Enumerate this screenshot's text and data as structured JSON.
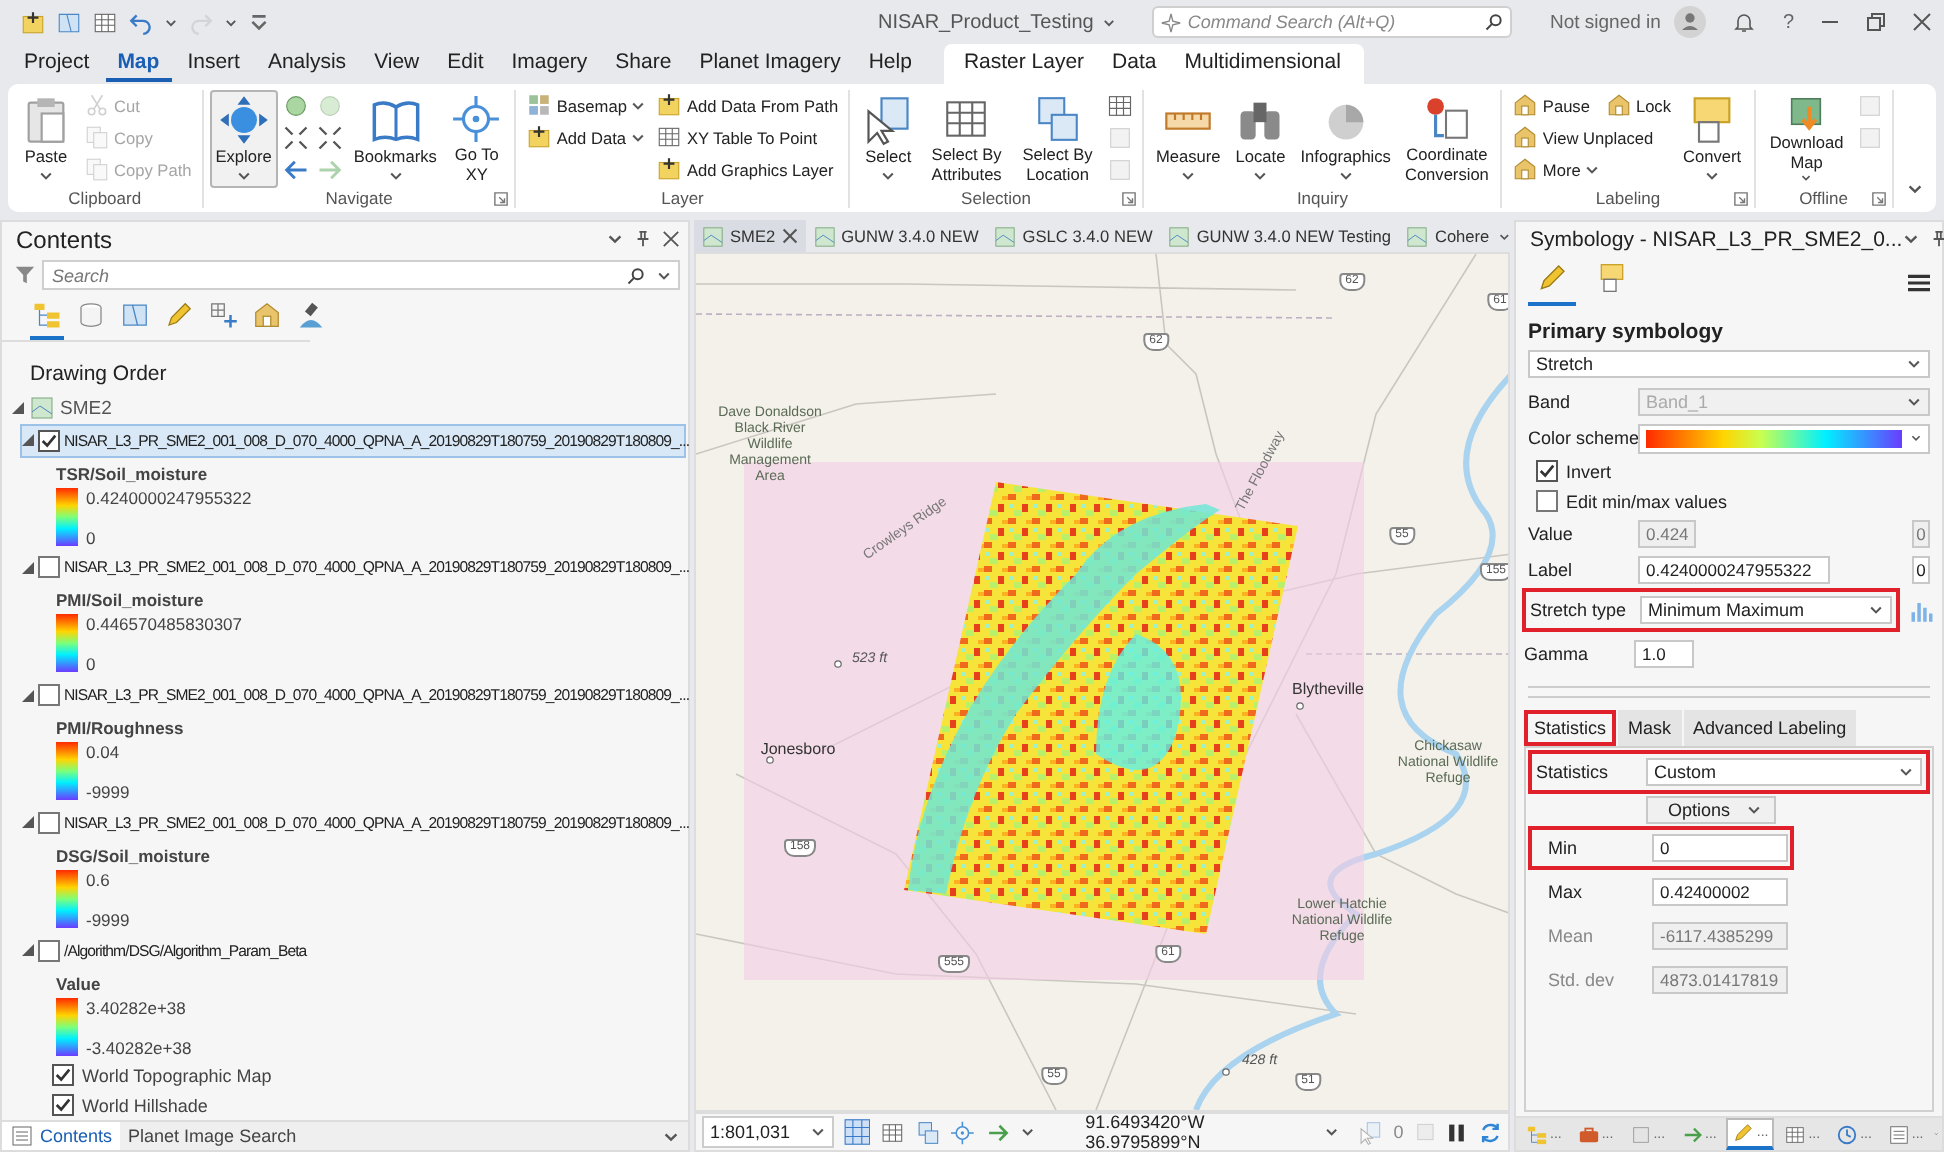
{
  "title_bar": {
    "title": "NISAR_Product_Testing",
    "search_placeholder": "Command Search (Alt+Q)",
    "account": "Not signed in",
    "help": "?"
  },
  "menu_tabs": [
    {
      "label": "Project",
      "selected": false,
      "kind": "core"
    },
    {
      "label": "Map",
      "selected": true,
      "kind": "core"
    },
    {
      "label": "Insert",
      "selected": false,
      "kind": "core"
    },
    {
      "label": "Analysis",
      "selected": false,
      "kind": "core"
    },
    {
      "label": "View",
      "selected": false,
      "kind": "core"
    },
    {
      "label": "Edit",
      "selected": false,
      "kind": "core"
    },
    {
      "label": "Imagery",
      "selected": false,
      "kind": "core"
    },
    {
      "label": "Share",
      "selected": false,
      "kind": "core"
    },
    {
      "label": "Planet Imagery",
      "selected": false,
      "kind": "core"
    },
    {
      "label": "Help",
      "selected": false,
      "kind": "core"
    },
    {
      "label": "Raster Layer",
      "selected": false,
      "kind": "context"
    },
    {
      "label": "Data",
      "selected": false,
      "kind": "context"
    },
    {
      "label": "Multidimensional",
      "selected": false,
      "kind": "context"
    }
  ],
  "ribbon": {
    "groups": [
      {
        "label": "Clipboard",
        "launcher": false,
        "columns": [
          [
            [
              {
                "kind": "large",
                "label": "Paste",
                "dropdown": true,
                "disabled": false,
                "active": false
              }
            ]
          ],
          [
            [
              {
                "kind": "small",
                "label": "Cut",
                "dropdown": false,
                "disabled": true,
                "active": false
              }
            ],
            [
              {
                "kind": "small",
                "label": "Copy",
                "dropdown": false,
                "disabled": true,
                "active": false
              }
            ],
            [
              {
                "kind": "small",
                "label": "Copy Path",
                "dropdown": false,
                "disabled": true,
                "active": false
              }
            ]
          ]
        ]
      },
      {
        "label": "Navigate",
        "launcher": true,
        "columns": [
          [
            [
              {
                "kind": "large",
                "label": "Explore",
                "dropdown": true,
                "disabled": false,
                "active": true
              }
            ]
          ],
          [
            [
              {
                "kind": "icon",
                "dropdown": false,
                "disabled": false,
                "active": false
              }
            ],
            [
              {
                "kind": "icon",
                "dropdown": false,
                "disabled": false,
                "active": false
              }
            ],
            [
              {
                "kind": "icon",
                "dropdown": false,
                "disabled": false,
                "active": false
              }
            ]
          ],
          [
            [
              {
                "kind": "icon",
                "dropdown": false,
                "disabled": true,
                "active": false
              }
            ],
            [
              {
                "kind": "icon",
                "dropdown": false,
                "disabled": false,
                "active": false
              }
            ],
            [
              {
                "kind": "icon",
                "dropdown": false,
                "disabled": true,
                "active": false
              }
            ]
          ],
          [
            [
              {
                "kind": "large",
                "label": "Bookmarks",
                "dropdown": true,
                "disabled": false,
                "active": false
              }
            ]
          ],
          [
            [
              {
                "kind": "large",
                "label": "Go To XY",
                "dropdown": false,
                "disabled": false,
                "active": false
              }
            ]
          ]
        ]
      },
      {
        "label": "Layer",
        "launcher": false,
        "columns": [
          [
            [
              {
                "kind": "small",
                "label": "Basemap",
                "dropdown": true,
                "disabled": false,
                "active": false
              }
            ],
            [
              {
                "kind": "small",
                "label": "Add Data",
                "dropdown": true,
                "disabled": false,
                "active": false
              }
            ]
          ],
          [
            [
              {
                "kind": "small",
                "label": "Add Data From Path",
                "dropdown": false,
                "disabled": false,
                "active": false
              }
            ],
            [
              {
                "kind": "small",
                "label": "XY Table To Point",
                "dropdown": false,
                "disabled": false,
                "active": false
              }
            ],
            [
              {
                "kind": "small",
                "label": "Add Graphics Layer",
                "dropdown": false,
                "disabled": false,
                "active": false
              }
            ]
          ]
        ]
      },
      {
        "label": "Selection",
        "launcher": true,
        "columns": [
          [
            [
              {
                "kind": "large",
                "label": "Select",
                "dropdown": true,
                "disabled": false,
                "active": false
              }
            ]
          ],
          [
            [
              {
                "kind": "large",
                "label": "Select By Attributes",
                "dropdown": false,
                "disabled": false,
                "active": false
              }
            ]
          ],
          [
            [
              {
                "kind": "large",
                "label": "Select By Location",
                "dropdown": false,
                "disabled": false,
                "active": false
              }
            ]
          ],
          [
            [
              {
                "kind": "icon",
                "dropdown": false,
                "disabled": false,
                "active": false
              }
            ],
            [
              {
                "kind": "icon",
                "dropdown": false,
                "disabled": true,
                "active": false
              }
            ],
            [
              {
                "kind": "icon",
                "dropdown": false,
                "disabled": true,
                "active": false
              }
            ]
          ]
        ]
      },
      {
        "label": "Inquiry",
        "launcher": false,
        "columns": [
          [
            [
              {
                "kind": "large",
                "label": "Measure",
                "dropdown": true,
                "disabled": false,
                "active": false
              }
            ]
          ],
          [
            [
              {
                "kind": "large",
                "label": "Locate",
                "dropdown": true,
                "disabled": false,
                "active": false
              }
            ]
          ],
          [
            [
              {
                "kind": "large",
                "label": "Infographics",
                "dropdown": true,
                "disabled": false,
                "active": false
              }
            ]
          ],
          [
            [
              {
                "kind": "large",
                "label": "Coordinate Conversion",
                "dropdown": false,
                "disabled": false,
                "active": false
              }
            ]
          ]
        ]
      },
      {
        "label": "Labeling",
        "launcher": true,
        "columns": [
          [
            [
              {
                "kind": "small",
                "label": "Pause",
                "dropdown": false,
                "disabled": false,
                "active": false
              },
              {
                "kind": "small",
                "label": "Lock",
                "dropdown": false,
                "disabled": false,
                "active": false
              }
            ],
            [
              {
                "kind": "small",
                "label": "View Unplaced",
                "dropdown": false,
                "disabled": false,
                "active": false
              }
            ],
            [
              {
                "kind": "small",
                "label": "More",
                "dropdown": true,
                "disabled": false,
                "active": false
              }
            ]
          ],
          [
            [
              {
                "kind": "large",
                "label": "Convert",
                "dropdown": true,
                "disabled": false,
                "active": false
              }
            ]
          ]
        ]
      },
      {
        "label": "Offline",
        "launcher": true,
        "columns": [
          [
            [
              {
                "kind": "large",
                "label": "Download Map",
                "dropdown": true,
                "disabled": false,
                "active": false
              }
            ]
          ],
          [
            [
              {
                "kind": "icon",
                "dropdown": false,
                "disabled": true,
                "active": false
              }
            ],
            [
              {
                "kind": "icon",
                "dropdown": false,
                "disabled": true,
                "active": false
              }
            ]
          ]
        ]
      }
    ]
  },
  "contents": {
    "title": "Contents",
    "search_placeholder": "Search",
    "view_tabs": [
      {
        "selected": true
      },
      {
        "selected": false
      },
      {
        "selected": false
      },
      {
        "selected": false
      },
      {
        "selected": false
      },
      {
        "selected": false
      },
      {
        "selected": false
      }
    ],
    "heading": "Drawing Order",
    "map": {
      "name": "SME2",
      "expanded": true,
      "children": [
        {
          "kind": "raster",
          "name": "NISAR_L3_PR_SME2_001_008_D_070_4000_QPNA_A_20190829T180759_20190829T180809_...",
          "checked": true,
          "selected": true,
          "expanded": true,
          "legend": {
            "field": "TSR/Soil_moisture",
            "max": "0.4240000247955322",
            "min": "0"
          }
        },
        {
          "kind": "raster",
          "name": "NISAR_L3_PR_SME2_001_008_D_070_4000_QPNA_A_20190829T180759_20190829T180809_...",
          "checked": false,
          "selected": false,
          "expanded": true,
          "legend": {
            "field": "PMI/Soil_moisture",
            "max": "0.446570485830307",
            "min": "0"
          }
        },
        {
          "kind": "raster",
          "name": "NISAR_L3_PR_SME2_001_008_D_070_4000_QPNA_A_20190829T180759_20190829T180809_...",
          "checked": false,
          "selected": false,
          "expanded": true,
          "legend": {
            "field": "PMI/Roughness",
            "max": "0.04",
            "min": "-9999"
          }
        },
        {
          "kind": "raster",
          "name": "NISAR_L3_PR_SME2_001_008_D_070_4000_QPNA_A_20190829T180759_20190829T180809_...",
          "checked": false,
          "selected": false,
          "expanded": true,
          "legend": {
            "field": "DSG/Soil_moisture",
            "max": "0.6",
            "min": "-9999"
          }
        },
        {
          "kind": "raster",
          "name": "/Algorithm/DSG/Algorithm_Param_Beta",
          "checked": false,
          "selected": false,
          "expanded": true,
          "legend": {
            "field": "Value",
            "max": "3.40282e+38",
            "min": "-3.40282e+38"
          }
        },
        {
          "kind": "basemap",
          "name": "World Topographic Map",
          "checked": true,
          "selected": false
        },
        {
          "kind": "basemap",
          "name": "World Hillshade",
          "checked": true,
          "selected": false
        }
      ]
    },
    "bottom_tabs": [
      {
        "label": "Contents",
        "selected": true
      },
      {
        "label": "Planet Image Search",
        "selected": false
      }
    ]
  },
  "map_view": {
    "tabs": [
      {
        "label": "SME2",
        "selected": true
      },
      {
        "label": "GUNW 3.4.0 NEW",
        "selected": false
      },
      {
        "label": "GSLC 3.4.0 NEW",
        "selected": false
      },
      {
        "label": "GUNW 3.4.0 NEW Testing",
        "selected": false
      },
      {
        "label": "Cohere",
        "selected": false
      }
    ],
    "labels": [
      {
        "text": "Dave Donaldson Black River Wildlife Management Area",
        "kind": "area"
      },
      {
        "text": "Crowleys Ridge",
        "kind": "feature"
      },
      {
        "text": "The Floodway",
        "kind": "feature"
      },
      {
        "text": "523 ft",
        "kind": "elevation"
      },
      {
        "text": "Jonesboro",
        "kind": "city"
      },
      {
        "text": "Blytheville",
        "kind": "city"
      },
      {
        "text": "Chickasaw National Wildlife Refuge",
        "kind": "area"
      },
      {
        "text": "Lower Hatchie National Wildlife Refuge",
        "kind": "area"
      },
      {
        "text": "428 ft",
        "kind": "elevation"
      },
      {
        "text": "62",
        "kind": "route"
      },
      {
        "text": "61",
        "kind": "route"
      },
      {
        "text": "62",
        "kind": "route"
      },
      {
        "text": "55",
        "kind": "route"
      },
      {
        "text": "155",
        "kind": "route"
      },
      {
        "text": "158",
        "kind": "route"
      },
      {
        "text": "555",
        "kind": "route"
      },
      {
        "text": "61",
        "kind": "route"
      },
      {
        "text": "55",
        "kind": "route"
      },
      {
        "text": "51",
        "kind": "route"
      }
    ],
    "scale": "1:801,031",
    "coordinates": "91.6493420°W 36.9795899°N",
    "selection_count": "0"
  },
  "symbology": {
    "title": "Symbology - NISAR_L3_PR_SME2_0...",
    "view_tabs": [
      {
        "selected": true
      },
      {
        "selected": false
      }
    ],
    "heading": "Primary symbology",
    "renderer": "Stretch",
    "band": {
      "label": "Band",
      "value": "Band_1",
      "disabled": true
    },
    "color_scheme": {
      "label": "Color scheme"
    },
    "options": [
      {
        "label": "Invert",
        "checked": true
      },
      {
        "label": "Edit min/max values",
        "checked": false
      }
    ],
    "value_row": {
      "label": "Value",
      "value": "0.424",
      "end": "0"
    },
    "label_row": {
      "label": "Label",
      "value": "0.4240000247955322",
      "end": "0"
    },
    "stretch_type": {
      "label": "Stretch type",
      "value": "Minimum Maximum",
      "highlighted": true
    },
    "gamma": {
      "label": "Gamma",
      "value": "1.0",
      "highlighted": false
    },
    "tabs": [
      {
        "label": "Statistics",
        "selected": true,
        "highlighted": true
      },
      {
        "label": "Mask",
        "selected": false,
        "highlighted": false
      },
      {
        "label": "Advanced Labeling",
        "selected": false,
        "highlighted": false
      }
    ],
    "statistics": {
      "label": "Statistics",
      "value": "Custom",
      "highlighted": true
    },
    "options_button": "Options",
    "stats": [
      {
        "label": "Min",
        "value": "0",
        "disabled": false,
        "highlighted": true
      },
      {
        "label": "Max",
        "value": "0.42400002",
        "disabled": false,
        "highlighted": false
      },
      {
        "label": "Mean",
        "value": "-6117.4385299",
        "disabled": true,
        "highlighted": false
      },
      {
        "label": "Std. dev",
        "value": "4873.01417819",
        "disabled": true,
        "highlighted": false
      }
    ]
  },
  "dock_tabs": [
    {
      "label": "...",
      "selected": false
    },
    {
      "label": "...",
      "selected": false
    },
    {
      "label": "...",
      "selected": false
    },
    {
      "label": "...",
      "selected": false
    },
    {
      "label": "...",
      "selected": true
    },
    {
      "label": "...",
      "selected": false
    },
    {
      "label": "...",
      "selected": false
    },
    {
      "label": "...",
      "selected": false
    }
  ]
}
